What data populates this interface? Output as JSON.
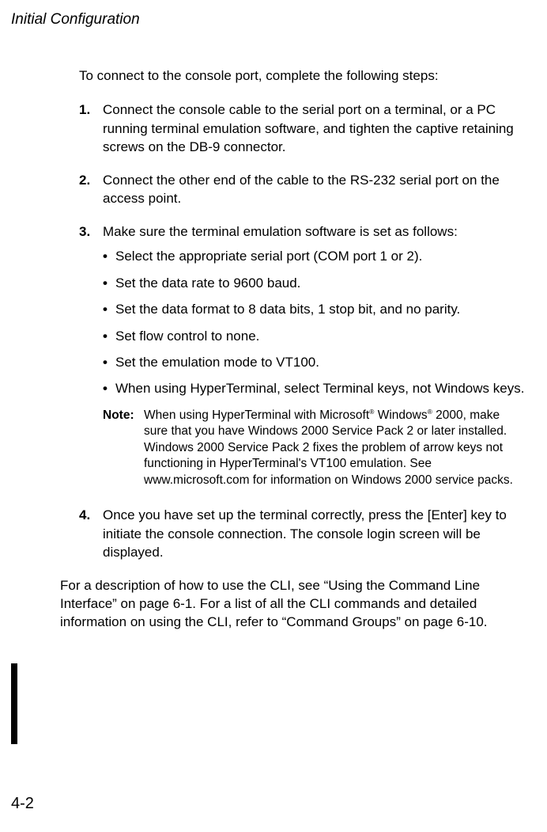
{
  "header": {
    "running_title": "Initial Configuration"
  },
  "intro": "To connect to the console port, complete the following steps:",
  "steps": {
    "s1": {
      "num": "1.",
      "text": "Connect the console cable to the serial port on a terminal, or a PC running terminal emulation software, and tighten the captive retaining screws on the DB-9 connector."
    },
    "s2": {
      "num": "2.",
      "text": "Connect the other end of the cable to the RS-232 serial port on the access point."
    },
    "s3": {
      "num": "3.",
      "lead": "Make sure the terminal emulation software is set as follows:",
      "bullets": {
        "b1": "Select the appropriate serial port (COM port 1 or 2).",
        "b2": "Set the data rate to 9600 baud.",
        "b3": "Set the data format to 8 data bits, 1 stop bit, and no parity.",
        "b4": "Set flow control to none.",
        "b5": "Set the emulation mode to VT100.",
        "b6": "When using HyperTerminal, select Terminal keys, not Windows keys."
      },
      "note": {
        "label": "Note:",
        "pre": "When using HyperTerminal with Microsoft",
        "mid1": " Windows",
        "post": " 2000, make sure that you have Windows 2000 Service Pack 2 or later installed. Windows 2000 Service Pack 2 fixes the problem of arrow keys not functioning in HyperTerminal's VT100 emulation. See www.microsoft.com for information on Windows 2000 service packs."
      }
    },
    "s4": {
      "num": "4.",
      "text": "Once you have set up the terminal correctly, press the [Enter] key to initiate the console connection. The console login screen will be displayed."
    }
  },
  "closing": "For a description of how to use the CLI, see “Using the Command Line Interface” on page 6-1. For a list of all the CLI commands and detailed information on using the CLI, refer to “Command Groups” on page 6-10.",
  "page_number": "4-2",
  "symbols": {
    "bullet": "•",
    "reg": "®"
  }
}
